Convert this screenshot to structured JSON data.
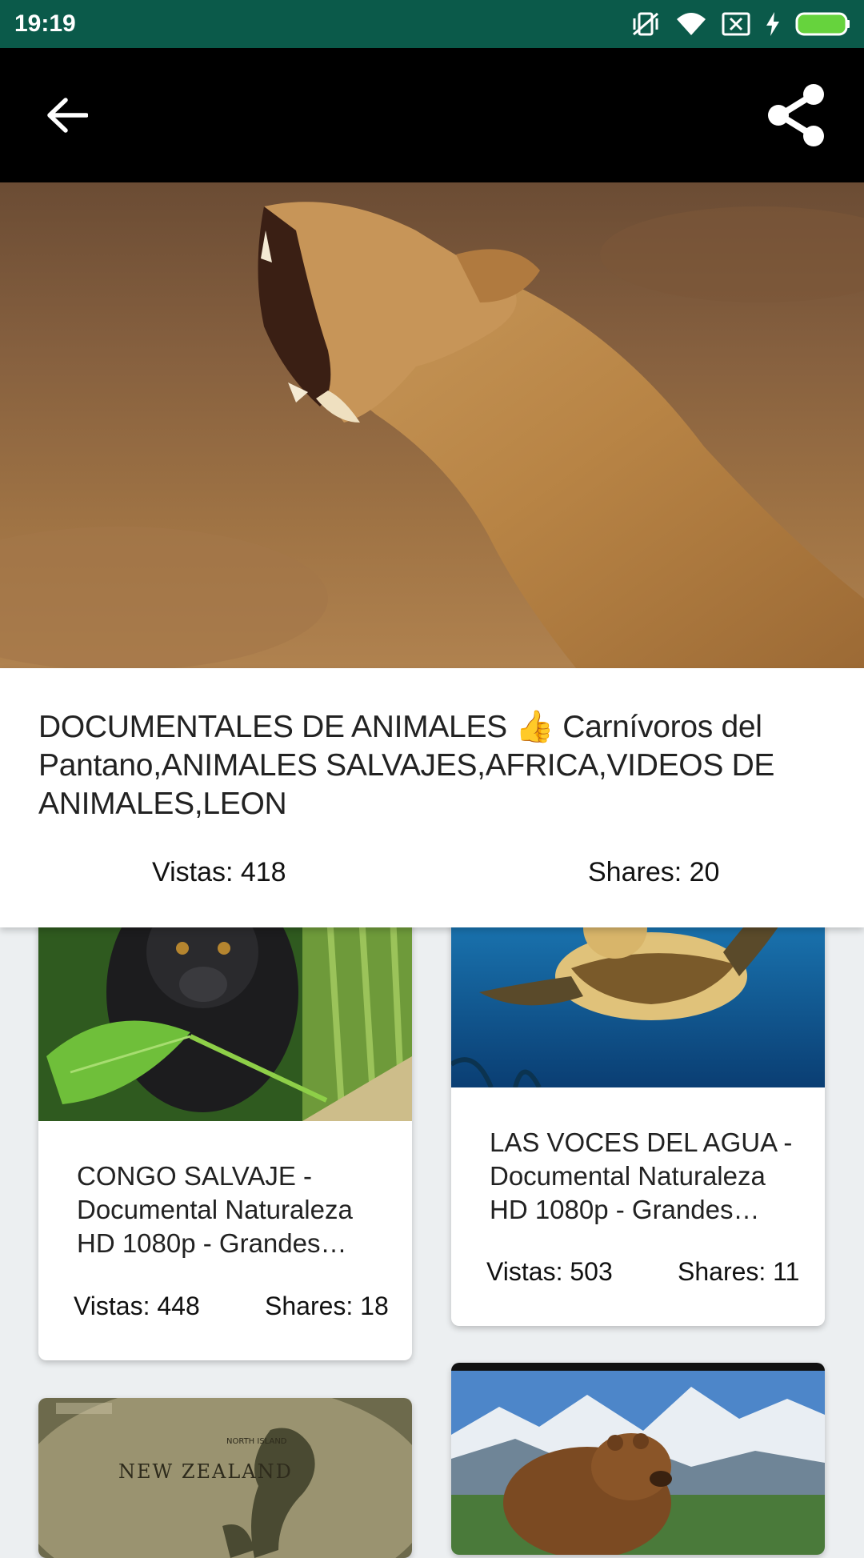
{
  "status_bar": {
    "time": "19:19",
    "icons": [
      "vibrate-off-icon",
      "wifi-icon",
      "sim-off-icon",
      "charging-icon",
      "battery-icon"
    ],
    "color": "#0b5a4a"
  },
  "toolbar": {
    "back_icon": "arrow-left-icon",
    "share_icon": "share-icon"
  },
  "detail": {
    "title": "DOCUMENTALES DE ANIMALES 👍 Carnívoros del Pantano,ANIMALES SALVAJES,AFRICA,VIDEOS DE ANIMALES,LEON",
    "views": "Vistas: 418",
    "shares": "Shares: 20"
  },
  "videos": [
    {
      "title": "CONGO SALVAJE - Documental Naturaleza HD 1080p - Grandes Documentales",
      "views": "Vistas: 448",
      "shares": "Shares: 18"
    },
    {
      "title": "LAS VOCES DEL AGUA  - Documental Naturaleza HD 1080p - Grandes Documentales",
      "views": "Vistas: 503",
      "shares": "Shares: 11"
    },
    {
      "map_label_main": "NEW ZEALAND",
      "map_label_small": "NORTH ISLAND"
    },
    {}
  ]
}
